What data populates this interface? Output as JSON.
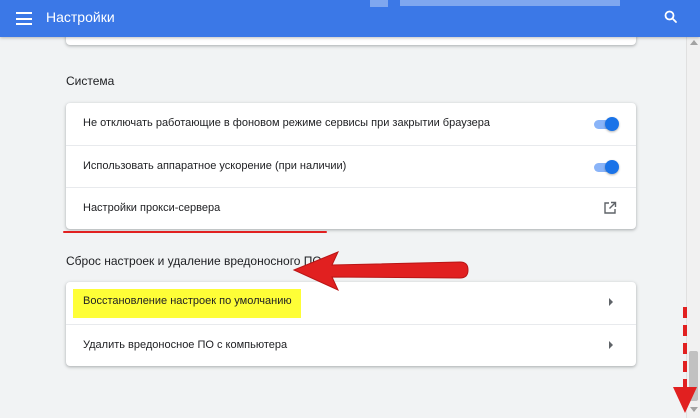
{
  "header": {
    "title": "Настройки",
    "menu_icon": "hamburger-icon",
    "search_icon": "search-icon",
    "color": "#3b78e7"
  },
  "system": {
    "title": "Система",
    "rows": [
      {
        "label": "Не отключать работающие в фоновом режиме сервисы при закрытии браузера",
        "control": "toggle",
        "checked": true
      },
      {
        "label": "Использовать аппаратное ускорение (при наличии)",
        "control": "toggle",
        "checked": true
      },
      {
        "label": "Настройки прокси-сервера",
        "control": "external-link-icon"
      }
    ]
  },
  "reset": {
    "title": "Сброс настроек и удаление вредоносного ПО",
    "rows": [
      {
        "label": "Восстановление настроек по умолчанию",
        "control": "chevron-right-icon",
        "highlighted": true
      },
      {
        "label": "Удалить вредоносное ПО с компьютера",
        "control": "chevron-right-icon"
      }
    ]
  },
  "annotations": {
    "highlight_color": "#fefe37",
    "marker_color": "#e12020"
  }
}
